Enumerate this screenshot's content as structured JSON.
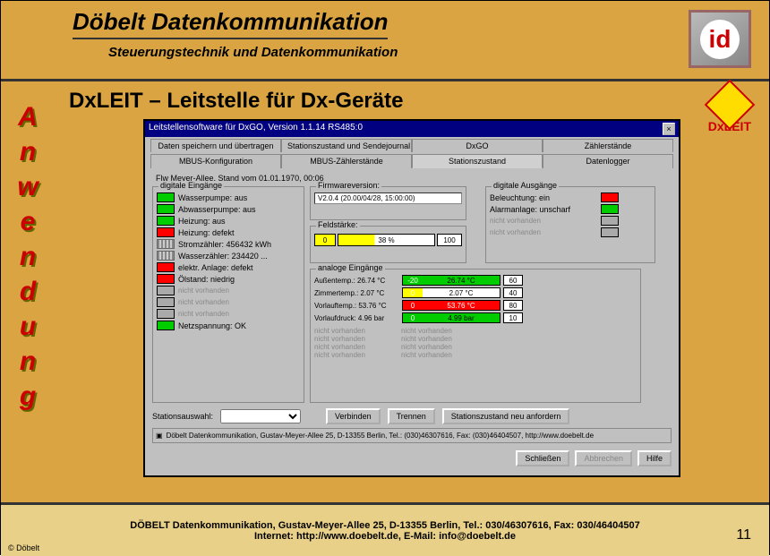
{
  "header": {
    "title": "Döbelt Datenkommunikation",
    "subtitle": "Steuerungstechnik und Datenkommunikation",
    "logo_text": "id"
  },
  "sidebar": {
    "label": "Anwendung"
  },
  "page": {
    "title": "DxLEIT – Leitstelle für Dx-Geräte",
    "product_label": "DxLEIT"
  },
  "window": {
    "title": "Leitstellensoftware für DxGO, Version 1.1.14   RS485:0",
    "tabs_top": [
      "Daten speichern und übertragen",
      "Stationszustand und Sendejournal",
      "DxGO",
      "Zählerstände"
    ],
    "tabs_bottom": [
      "MBUS-Konfiguration",
      "MBUS-Zählerstände",
      "Stationszustand",
      "Datenlogger"
    ],
    "active_tab": "Stationszustand",
    "status_line": "Flw Meyer-Allee, Stand vom 01.01.1970, 00:06",
    "digital_inputs_title": "digitale Eingänge",
    "digital_inputs": [
      {
        "color": "green",
        "label": "Wasserpumpe: aus"
      },
      {
        "color": "green",
        "label": "Abwasserpumpe: aus"
      },
      {
        "color": "green",
        "label": "Heizung: aus"
      },
      {
        "color": "red",
        "label": "Heizung: defekt"
      },
      {
        "color": "counter",
        "label": "Stromzähler: 456432 kWh"
      },
      {
        "color": "counter",
        "label": "Wasserzähler: 234420 ..."
      },
      {
        "color": "red",
        "label": "elektr. Anlage: defekt"
      },
      {
        "color": "red",
        "label": "Ölstand: niedrig"
      },
      {
        "color": "gray",
        "label": "nicht vorhanden",
        "disabled": true
      },
      {
        "color": "gray",
        "label": "nicht vorhanden",
        "disabled": true
      },
      {
        "color": "gray",
        "label": "nicht vorhanden",
        "disabled": true
      },
      {
        "color": "green",
        "label": "Netzspannung: OK"
      }
    ],
    "firmware_title": "Firmwareversion:",
    "firmware_value": "V2.0.4 (20.00/04/28, 15:00:00)",
    "fieldstrength_title": "Feldstärke:",
    "fieldstrength": {
      "min": "0",
      "value": "38 %",
      "max": "100"
    },
    "digital_outputs_title": "digitale Ausgänge",
    "digital_outputs": [
      {
        "color": "red",
        "label": "Beleuchtung: ein"
      },
      {
        "color": "green",
        "label": "Alarmanlage: unscharf"
      },
      {
        "color": "gray",
        "label": "nicht vorhanden",
        "disabled": true
      },
      {
        "color": "gray",
        "label": "nicht vorhanden",
        "disabled": true
      }
    ],
    "analog_title": "analoge Eingänge",
    "analog": [
      {
        "label": "Außentemp.: 26.74 °C",
        "left": "-20",
        "val": "26.74 °C",
        "max": "60",
        "bar_color": "#0c0"
      },
      {
        "label": "Zimmertemp.: 2.07 °C",
        "left": "0",
        "val": "2.07 °C",
        "max": "40",
        "bar_color": "#ff0"
      },
      {
        "label": "Vorlauftemp.: 53.76 °C",
        "left": "0",
        "val": "53.76 °C",
        "max": "80",
        "bar_color": "#f00"
      },
      {
        "label": "Vorlaufdruck: 4.96 bar",
        "left": "0",
        "val": "4.99 bar",
        "max": "10",
        "bar_color": "#0c0"
      }
    ],
    "analog_disabled": [
      "nicht vorhanden",
      "nicht vorhanden",
      "nicht vorhanden",
      "nicht vorhanden"
    ],
    "analog_disabled_right": [
      "nicht vorhanden",
      "nicht vorhanden",
      "nicht vorhanden",
      "nicht vorhanden"
    ],
    "station_label": "Stationsauswahl:",
    "btn_connect": "Verbinden",
    "btn_disconnect": "Trennen",
    "btn_refresh": "Stationszustand neu anfordern",
    "address": "Döbelt Datenkommunikation, Gustav-Meyer-Allee 25, D-13355 Berlin, Tel.: (030)46307616, Fax: (030)46404507, http://www.doebelt.de",
    "btn_close": "Schließen",
    "btn_abort": "Abbrechen",
    "btn_help": "Hilfe"
  },
  "footer": {
    "copyright": "© Döbelt",
    "line1": "DÖBELT Datenkommunikation, Gustav-Meyer-Allee 25, D-13355 Berlin, Tel.: 030/46307616, Fax: 030/46404507",
    "line2": "Internet: http://www.doebelt.de, E-Mail: info@doebelt.de",
    "page": "11"
  }
}
